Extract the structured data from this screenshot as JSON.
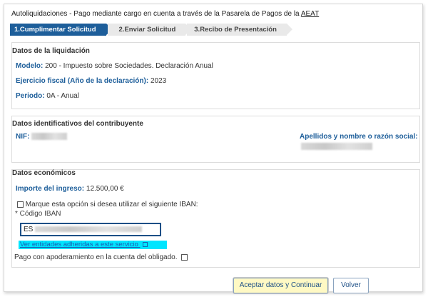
{
  "header": {
    "title_prefix": "Autoliquidaciones - Pago mediante cargo en cuenta a través de la Pasarela de Pagos de la ",
    "title_link": "AEAT"
  },
  "steps": [
    {
      "label": "1.Cumplimentar Solicitud"
    },
    {
      "label": "2.Enviar Solicitud"
    },
    {
      "label": "3.Recibo de Presentación"
    }
  ],
  "liquidacion": {
    "title": "Datos de la liquidación",
    "modelo_label": "Modelo:",
    "modelo_value": "200 - Impuesto sobre Sociedades. Declaración Anual",
    "ejercicio_label": "Ejercicio fiscal (Año de la declaración):",
    "ejercicio_value": "2023",
    "periodo_label": "Periodo:",
    "periodo_value": "0A - Anual"
  },
  "contribuyente": {
    "title": "Datos identificativos del contribuyente",
    "nif_label": "NIF:",
    "nombre_label": "Apellidos y nombre o razón social:"
  },
  "economicos": {
    "title": "Datos económicos",
    "importe_label": "Importe del ingreso:",
    "importe_value": "12.500,00 €",
    "iban_option_label": "Marque esta opción si desea utilizar el siguiente IBAN:",
    "iban_field_label": "* Código IBAN",
    "iban_value": "ES",
    "entidades_link": "Ver entidades adheridas a este servicio",
    "apoderamiento_label": "Pago con apoderamiento en la cuenta del obligado."
  },
  "actions": {
    "accept_label": "Aceptar datos y Continuar",
    "back_label": "Volver"
  }
}
